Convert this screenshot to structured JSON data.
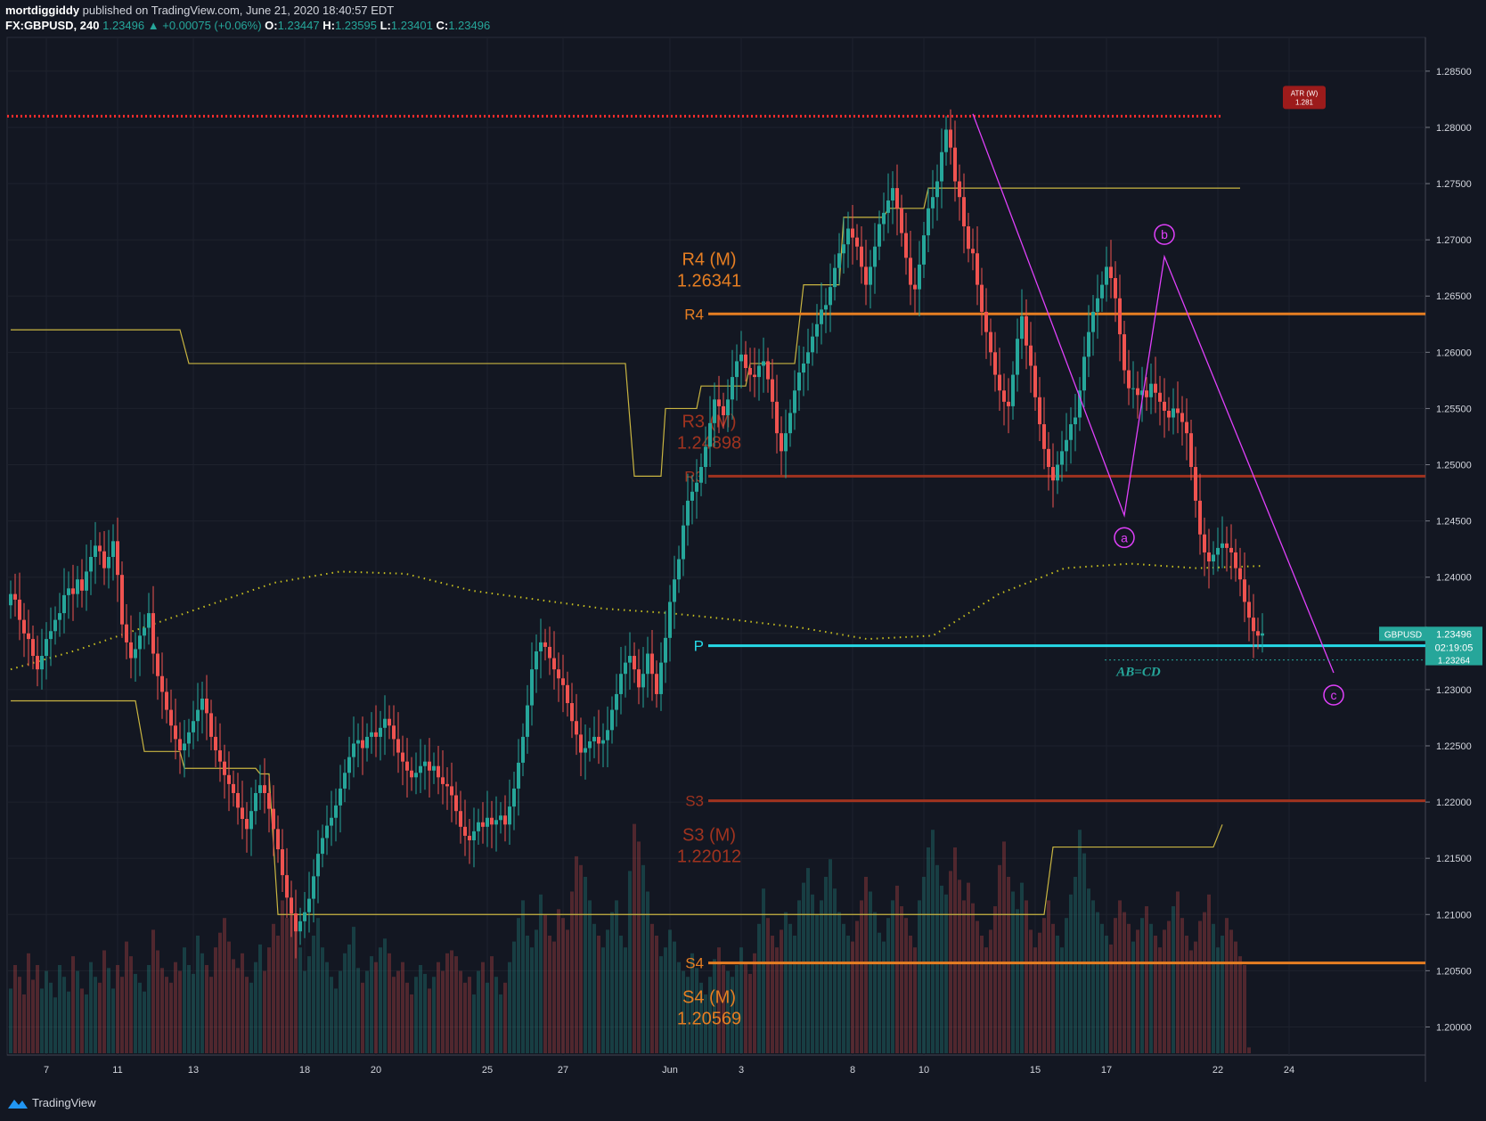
{
  "header": {
    "author": "mortdiggiddy",
    "published_text": "published on TradingView.com, June 21, 2020 18:40:57 EDT",
    "symbol": "FX:GBPUSD, 240",
    "last": "1.23496",
    "change": "+0.00075 (+0.06%)",
    "o_label": "O:",
    "o_val": "1.23447",
    "h_label": "H:",
    "h_val": "1.23595",
    "l_label": "L:",
    "l_val": "1.23401",
    "c_label": "C:",
    "c_val": "1.23496"
  },
  "footer": {
    "brand": "TradingView"
  },
  "colors": {
    "background": "#131722",
    "up": "#26a69a",
    "down": "#ef5350",
    "pivot_orange": "#e67e22",
    "pivot_dark": "#a0331f",
    "pivot_cyan": "#26d9e6",
    "atr_red": "#ff2d2d",
    "harmonic": "#e040fb",
    "yellow": "#c9b541"
  },
  "chart_data": {
    "type": "candlestick",
    "symbol": "GBPUSD",
    "timeframe": "240",
    "ylim": [
      1.1975,
      1.288
    ],
    "y_ticks": [
      "1.28500",
      "1.28000",
      "1.27500",
      "1.27000",
      "1.26500",
      "1.26000",
      "1.25500",
      "1.25000",
      "1.24500",
      "1.24000",
      "1.23500",
      "1.23000",
      "1.22500",
      "1.22000",
      "1.21500",
      "1.21000",
      "1.20500",
      "1.20000"
    ],
    "x_ticks": [
      {
        "label": "7",
        "idx": 8
      },
      {
        "label": "11",
        "idx": 24
      },
      {
        "label": "13",
        "idx": 41
      },
      {
        "label": "18",
        "idx": 66
      },
      {
        "label": "20",
        "idx": 82
      },
      {
        "label": "25",
        "idx": 107
      },
      {
        "label": "27",
        "idx": 124
      },
      {
        "label": "Jun",
        "idx": 148
      },
      {
        "label": "3",
        "idx": 164
      },
      {
        "label": "8",
        "idx": 189
      },
      {
        "label": "10",
        "idx": 205
      },
      {
        "label": "15",
        "idx": 230
      },
      {
        "label": "17",
        "idx": 246
      },
      {
        "label": "22",
        "idx": 271
      },
      {
        "label": "24",
        "idx": 287
      }
    ],
    "closes": [
      1.2385,
      1.238,
      1.2362,
      1.235,
      1.2345,
      1.233,
      1.2318,
      1.233,
      1.2345,
      1.2352,
      1.2362,
      1.2368,
      1.2384,
      1.239,
      1.2385,
      1.2398,
      1.2388,
      1.2405,
      1.2418,
      1.2428,
      1.2423,
      1.2408,
      1.2418,
      1.2432,
      1.2402,
      1.2358,
      1.2342,
      1.2328,
      1.2336,
      1.2348,
      1.2355,
      1.2368,
      1.2332,
      1.2312,
      1.2298,
      1.2282,
      1.2268,
      1.2256,
      1.2246,
      1.2252,
      1.2262,
      1.2272,
      1.2282,
      1.2292,
      1.2279,
      1.2258,
      1.2246,
      1.2236,
      1.2224,
      1.2216,
      1.2208,
      1.2195,
      1.2185,
      1.2176,
      1.2192,
      1.2208,
      1.2215,
      1.2208,
      1.2194,
      1.2176,
      1.2158,
      1.2135,
      1.2115,
      1.2101,
      1.2085,
      1.2094,
      1.2102,
      1.2114,
      1.2134,
      1.2154,
      1.2168,
      1.2179,
      1.2186,
      1.2197,
      1.2212,
      1.2226,
      1.224,
      1.2252,
      1.2255,
      1.2248,
      1.2258,
      1.2262,
      1.2258,
      1.2266,
      1.2274,
      1.2268,
      1.2256,
      1.2244,
      1.2236,
      1.2228,
      1.2222,
      1.2226,
      1.2232,
      1.2236,
      1.2228,
      1.2232,
      1.2222,
      1.2216,
      1.2214,
      1.2206,
      1.2192,
      1.2178,
      1.217,
      1.2166,
      1.2174,
      1.2182,
      1.2178,
      1.2186,
      1.218,
      1.2184,
      1.2188,
      1.218,
      1.2196,
      1.2212,
      1.2235,
      1.2258,
      1.2286,
      1.2318,
      1.2334,
      1.2342,
      1.2338,
      1.2328,
      1.2318,
      1.231,
      1.2304,
      1.2288,
      1.2272,
      1.226,
      1.2244,
      1.2248,
      1.2254,
      1.2258,
      1.2252,
      1.2255,
      1.2264,
      1.2282,
      1.2296,
      1.2314,
      1.2324,
      1.233,
      1.2318,
      1.2302,
      1.2314,
      1.2332,
      1.2314,
      1.2296,
      1.2324,
      1.2346,
      1.2378,
      1.2398,
      1.2416,
      1.2446,
      1.2468,
      1.2476,
      1.2484,
      1.2498,
      1.2516,
      1.2537,
      1.2558,
      1.2552,
      1.2544,
      1.2558,
      1.2578,
      1.2592,
      1.2598,
      1.2586,
      1.258,
      1.2578,
      1.2588,
      1.2592,
      1.2576,
      1.2556,
      1.2528,
      1.2512,
      1.2528,
      1.2546,
      1.2566,
      1.2582,
      1.259,
      1.26,
      1.2614,
      1.2625,
      1.2638,
      1.2642,
      1.2658,
      1.2675,
      1.2688,
      1.2696,
      1.271,
      1.2702,
      1.2694,
      1.2676,
      1.266,
      1.2676,
      1.2694,
      1.2714,
      1.2724,
      1.2735,
      1.2746,
      1.2728,
      1.2706,
      1.2684,
      1.266,
      1.2656,
      1.2678,
      1.2704,
      1.2728,
      1.2738,
      1.2752,
      1.2778,
      1.2798,
      1.2782,
      1.2752,
      1.2738,
      1.2712,
      1.2692,
      1.2688,
      1.266,
      1.2636,
      1.2618,
      1.26,
      1.258,
      1.2566,
      1.2556,
      1.2552,
      1.258,
      1.2612,
      1.2632,
      1.2606,
      1.2588,
      1.256,
      1.2536,
      1.2514,
      1.2498,
      1.2486,
      1.25,
      1.2512,
      1.2522,
      1.2536,
      1.2542,
      1.2566,
      1.2596,
      1.2618,
      1.2636,
      1.2648,
      1.266,
      1.2676,
      1.2666,
      1.2648,
      1.2616,
      1.2584,
      1.2568,
      1.2568,
      1.2562,
      1.2566,
      1.256,
      1.2572,
      1.2564,
      1.2556,
      1.2548,
      1.2542,
      1.255,
      1.2546,
      1.2538,
      1.2528,
      1.2498,
      1.2468,
      1.2438,
      1.2422,
      1.2414,
      1.242,
      1.2426,
      1.243,
      1.2426,
      1.2422,
      1.2408,
      1.2398,
      1.2378,
      1.2364,
      1.2352,
      1.2348,
      1.235
    ],
    "first_open": 1.2375,
    "volume_max": 1.0,
    "volumes": [
      0.22,
      0.3,
      0.26,
      0.2,
      0.34,
      0.25,
      0.3,
      0.22,
      0.28,
      0.24,
      0.19,
      0.3,
      0.26,
      0.21,
      0.33,
      0.28,
      0.22,
      0.2,
      0.31,
      0.26,
      0.24,
      0.35,
      0.29,
      0.22,
      0.3,
      0.26,
      0.38,
      0.33,
      0.27,
      0.24,
      0.21,
      0.3,
      0.42,
      0.35,
      0.29,
      0.26,
      0.24,
      0.31,
      0.28,
      0.36,
      0.3,
      0.27,
      0.4,
      0.34,
      0.3,
      0.26,
      0.36,
      0.41,
      0.46,
      0.38,
      0.32,
      0.29,
      0.34,
      0.26,
      0.24,
      0.31,
      0.37,
      0.28,
      0.36,
      0.44,
      0.4,
      0.52,
      0.46,
      0.48,
      0.42,
      0.36,
      0.28,
      0.33,
      0.4,
      0.46,
      0.36,
      0.31,
      0.26,
      0.22,
      0.28,
      0.34,
      0.37,
      0.43,
      0.29,
      0.24,
      0.28,
      0.33,
      0.31,
      0.36,
      0.39,
      0.34,
      0.26,
      0.28,
      0.31,
      0.24,
      0.2,
      0.26,
      0.3,
      0.27,
      0.22,
      0.26,
      0.31,
      0.28,
      0.34,
      0.35,
      0.33,
      0.28,
      0.24,
      0.26,
      0.2,
      0.28,
      0.31,
      0.24,
      0.33,
      0.26,
      0.2,
      0.24,
      0.31,
      0.38,
      0.46,
      0.52,
      0.4,
      0.36,
      0.42,
      0.54,
      0.47,
      0.4,
      0.38,
      0.49,
      0.46,
      0.42,
      0.55,
      0.67,
      0.64,
      0.6,
      0.52,
      0.44,
      0.4,
      0.36,
      0.42,
      0.48,
      0.52,
      0.4,
      0.36,
      0.62,
      0.78,
      0.72,
      0.64,
      0.55,
      0.44,
      0.4,
      0.33,
      0.36,
      0.42,
      0.38,
      0.31,
      0.28,
      0.26,
      0.34,
      0.29,
      0.24,
      0.2,
      0.26,
      0.32,
      0.36,
      0.3,
      0.28,
      0.26,
      0.3,
      0.36,
      0.31,
      0.27,
      0.34,
      0.44,
      0.56,
      0.46,
      0.4,
      0.36,
      0.42,
      0.48,
      0.44,
      0.4,
      0.52,
      0.58,
      0.63,
      0.54,
      0.47,
      0.52,
      0.6,
      0.66,
      0.56,
      0.48,
      0.44,
      0.4,
      0.38,
      0.45,
      0.52,
      0.6,
      0.55,
      0.48,
      0.41,
      0.38,
      0.46,
      0.52,
      0.57,
      0.5,
      0.46,
      0.4,
      0.36,
      0.52,
      0.6,
      0.7,
      0.76,
      0.64,
      0.57,
      0.54,
      0.62,
      0.7,
      0.59,
      0.52,
      0.58,
      0.51,
      0.45,
      0.4,
      0.36,
      0.42,
      0.5,
      0.64,
      0.72,
      0.6,
      0.55,
      0.49,
      0.58,
      0.52,
      0.42,
      0.36,
      0.41,
      0.46,
      0.52,
      0.44,
      0.4,
      0.36,
      0.46,
      0.54,
      0.6,
      0.76,
      0.68,
      0.56,
      0.52,
      0.48,
      0.44,
      0.4,
      0.37,
      0.46,
      0.52,
      0.48,
      0.44,
      0.38,
      0.42,
      0.46,
      0.5,
      0.44,
      0.4,
      0.36,
      0.42,
      0.45,
      0.5,
      0.55,
      0.46,
      0.4,
      0.35,
      0.38,
      0.45,
      0.48,
      0.54,
      0.44,
      0.36,
      0.4,
      0.46,
      0.42,
      0.38,
      0.33,
      0.3,
      0.02
    ],
    "atr_level": 1.281,
    "atr_badge": {
      "line1": "ATR (W)",
      "line2": "1.281"
    },
    "pivots": [
      {
        "label": "R4",
        "value": 1.26341,
        "title": "R4 (M)",
        "price": "1.26341",
        "color": "#e67e22"
      },
      {
        "label": "R3",
        "value": 1.24898,
        "title": "R3 (M)",
        "price": "1.24898",
        "color": "#a0331f"
      },
      {
        "label": "P",
        "value": 1.2339,
        "color": "#26d9e6"
      },
      {
        "label": "S3",
        "value": 1.22012,
        "title": "S3 (M)",
        "price": "1.22012",
        "color": "#a0331f"
      },
      {
        "label": "S4",
        "value": 1.20569,
        "title": "S4 (M)",
        "price": "1.20569",
        "color": "#e67e22"
      }
    ],
    "abcd": {
      "label": "AB=CD",
      "value": 1.23264,
      "points": [
        {
          "name": "a",
          "value": 1.2455
        },
        {
          "name": "b",
          "value": 1.2685
        },
        {
          "name": "c",
          "value": 1.2315
        }
      ]
    },
    "price_tag": {
      "symbol": "GBPUSD",
      "price": "1.23496",
      "countdown": "02:19:05",
      "ab_price": "1.23264"
    },
    "ma_levels": [
      1.262,
      1.259,
      1.229,
      1.2245,
      1.21,
      1.216,
      1.218
    ],
    "dotted_ma": [
      1.2318,
      1.2335,
      1.2355,
      1.2375,
      1.2395,
      1.2405,
      1.2403,
      1.2388,
      1.238,
      1.2372,
      1.2368,
      1.2362,
      1.2355,
      1.2345,
      1.2348,
      1.2385,
      1.2408,
      1.2412,
      1.2408,
      1.241
    ]
  }
}
